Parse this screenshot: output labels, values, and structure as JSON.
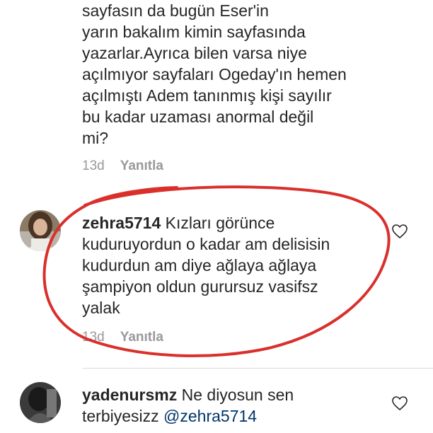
{
  "comments": [
    {
      "text": "sayfasın da bugün Eser'in\nyarın bakalım kimin sayfasında\nyazarlar.Ayrıca bilen varsa niye\naçılmıyor sayfaları Ogeday'ın hemen\naçılmıştı Adem tanınmış kişi sayılır\nbu kadar uzaması anormal değil\nmi?",
      "time": "13d",
      "reply_label": "Yanıtla"
    },
    {
      "username": "zehra5714",
      "text_first_line": " Kızları görünce",
      "text_rest": "kuduruyordun o kadar am delisisin\nkudurdun am diye ağlaya ağlaya\nşampiyon oldun gurursuz vasifsz\nyalak",
      "time": "13d",
      "reply_label": "Yanıtla",
      "icon": "heart-outline-icon"
    },
    {
      "username": "yadenursmz",
      "text_first_line": " Ne diyosun sen",
      "text_rest_prefix": "terbiyesizz ",
      "mention": "@zehra5714",
      "icon": "heart-outline-icon"
    }
  ],
  "colors": {
    "text": "#262626",
    "meta": "#999999",
    "mention": "#003569",
    "annotation_circle": "#d9302c"
  }
}
